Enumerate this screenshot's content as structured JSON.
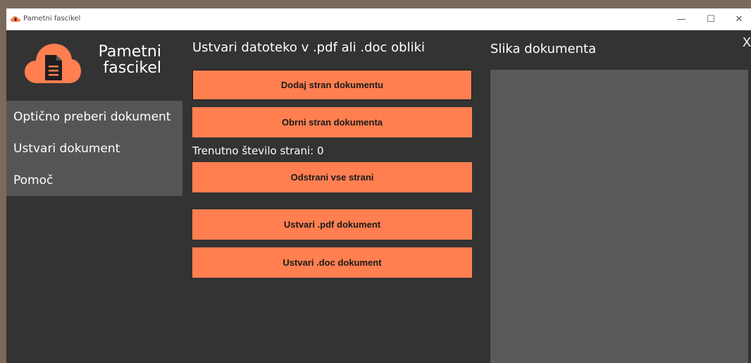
{
  "window": {
    "title": "Pametni fascikel",
    "minimize_glyph": "—",
    "maximize_glyph": "☐",
    "close_glyph": "✕",
    "app_icon": "cloud-icon"
  },
  "brand": {
    "line1": "Pametni",
    "line2": "fascikel",
    "logo_icon": "cloud-document-icon",
    "accent": "#ff7f50"
  },
  "sidebar": {
    "items": [
      {
        "label": "Optično preberi dokument"
      },
      {
        "label": "Ustvari dokument"
      },
      {
        "label": "Pomoč"
      }
    ]
  },
  "main": {
    "heading": "Ustvari datoteko v .pdf ali .doc obliki",
    "buttons": {
      "add_page": "Dodaj stran dokumentu",
      "rotate_page": "Obrni stran dokumenta",
      "remove_all": "Odstrani vse strani",
      "create_pdf": "Ustvari .pdf dokument",
      "create_doc": "Ustvari .doc dokument"
    },
    "page_count_label": "Trenutno število strani: 0"
  },
  "preview": {
    "heading": "Slika dokumenta",
    "close_glyph": "X"
  }
}
